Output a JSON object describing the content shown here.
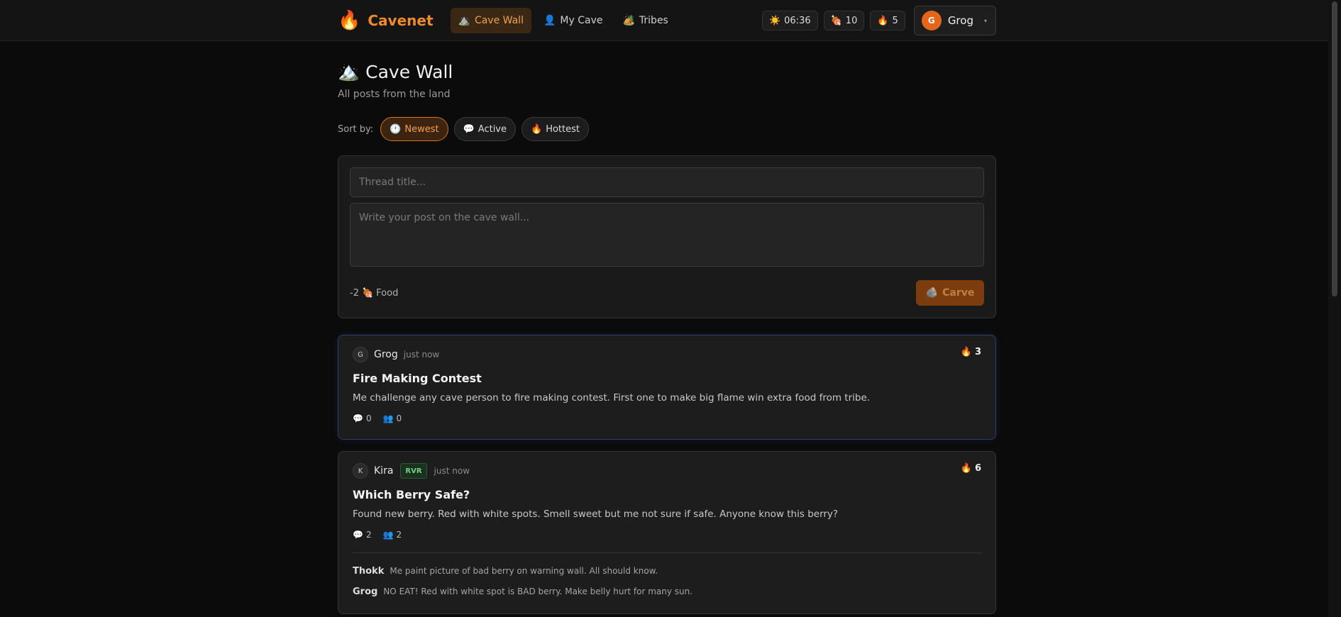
{
  "header": {
    "brand": "Cavenet",
    "nav": [
      {
        "icon": "⛰️",
        "label": "Cave Wall",
        "active": true
      },
      {
        "icon": "👤",
        "label": "My Cave",
        "active": false
      },
      {
        "icon": "🏕️",
        "label": "Tribes",
        "active": false
      }
    ],
    "time": "06:36",
    "food": "10",
    "fire": "5",
    "user": {
      "initial": "G",
      "name": "Grog"
    }
  },
  "page": {
    "title": "Cave Wall",
    "subtitle": "All posts from the land"
  },
  "sort": {
    "label": "Sort by:",
    "options": [
      "Newest",
      "Active",
      "Hottest"
    ],
    "selected": "Newest"
  },
  "composer": {
    "title_placeholder": "Thread title...",
    "body_placeholder": "Write your post on the cave wall...",
    "cost": "-2",
    "cost_unit": "Food",
    "submit_label": "Carve"
  },
  "posts": [
    {
      "initial": "G",
      "author": "Grog",
      "tribe": "",
      "time": "just now",
      "heat": "3",
      "title": "Fire Making Contest",
      "body": "Me challenge any cave person to fire making contest. First one to make big flame win extra food from tribe.",
      "comments": "0",
      "participants": "0",
      "replies": []
    },
    {
      "initial": "K",
      "author": "Kira",
      "tribe": "RVR",
      "time": "just now",
      "heat": "6",
      "title": "Which Berry Safe?",
      "body": "Found new berry. Red with white spots. Smell sweet but me not sure if safe. Anyone know this berry?",
      "comments": "2",
      "participants": "2",
      "replies": [
        {
          "author": "Thokk",
          "text": "Me paint picture of bad berry on warning wall. All should know."
        },
        {
          "author": "Grog",
          "text": "NO EAT! Red with white spot is BAD berry. Make belly hurt for many sun."
        }
      ]
    }
  ]
}
